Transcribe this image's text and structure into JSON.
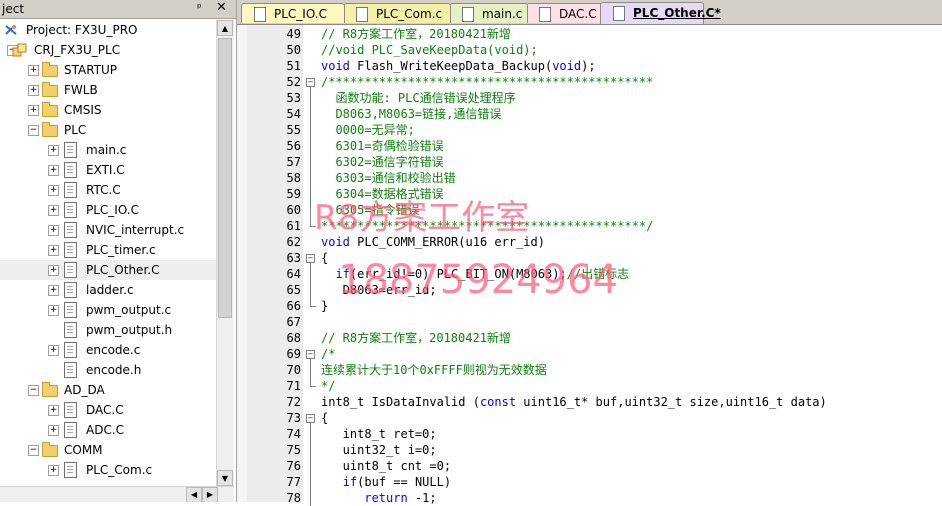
{
  "project_pane": {
    "title": "ject",
    "pin_glyph": "ᵖ",
    "close_glyph": "✕",
    "tree": [
      {
        "label": "Project: FX3U_PRO",
        "level": 0,
        "kind": "project",
        "expander": ""
      },
      {
        "label": "CRJ_FX3U_PLC",
        "level": 1,
        "kind": "target",
        "expander": "−"
      },
      {
        "label": "STARTUP",
        "level": 2,
        "kind": "folder",
        "expander": "+"
      },
      {
        "label": "FWLB",
        "level": 2,
        "kind": "folder",
        "expander": "+"
      },
      {
        "label": "CMSIS",
        "level": 2,
        "kind": "folder",
        "expander": "+"
      },
      {
        "label": "PLC",
        "level": 2,
        "kind": "folder",
        "expander": "−"
      },
      {
        "label": "main.c",
        "level": 3,
        "kind": "file",
        "expander": "+"
      },
      {
        "label": "EXTI.C",
        "level": 3,
        "kind": "file",
        "expander": "+"
      },
      {
        "label": "RTC.C",
        "level": 3,
        "kind": "file",
        "expander": "+"
      },
      {
        "label": "PLC_IO.C",
        "level": 3,
        "kind": "file",
        "expander": "+"
      },
      {
        "label": "NVIC_interrupt.c",
        "level": 3,
        "kind": "file",
        "expander": "+"
      },
      {
        "label": "PLC_timer.c",
        "level": 3,
        "kind": "file",
        "expander": "+"
      },
      {
        "label": "PLC_Other.C",
        "level": 3,
        "kind": "file",
        "expander": "+",
        "selected": true
      },
      {
        "label": "ladder.c",
        "level": 3,
        "kind": "file",
        "expander": "+"
      },
      {
        "label": "pwm_output.c",
        "level": 3,
        "kind": "file",
        "expander": "+"
      },
      {
        "label": "pwm_output.h",
        "level": 3,
        "kind": "file",
        "expander": ""
      },
      {
        "label": "encode.c",
        "level": 3,
        "kind": "file",
        "expander": "+"
      },
      {
        "label": "encode.h",
        "level": 3,
        "kind": "file",
        "expander": ""
      },
      {
        "label": "AD_DA",
        "level": 2,
        "kind": "folder",
        "expander": "−"
      },
      {
        "label": "DAC.C",
        "level": 3,
        "kind": "file",
        "expander": "+"
      },
      {
        "label": "ADC.C",
        "level": 3,
        "kind": "file",
        "expander": "+"
      },
      {
        "label": "COMM",
        "level": 2,
        "kind": "folder",
        "expander": "−"
      },
      {
        "label": "PLC_Com.c",
        "level": 3,
        "kind": "file",
        "expander": "+"
      }
    ]
  },
  "tabs": [
    {
      "label": "PLC_IO.C",
      "color": "#fff7c2",
      "active": false
    },
    {
      "label": "PLC_Com.c",
      "color": "#f5efa8",
      "active": false
    },
    {
      "label": "main.c",
      "color": "#e6f0c4",
      "active": false
    },
    {
      "label": "DAC.C",
      "color": "#fbe1e6",
      "active": false
    },
    {
      "label": "PLC_Other.C*",
      "color": "#e5d9f3",
      "active": true
    }
  ],
  "code_lines": [
    {
      "n": "49",
      "fold": "",
      "spans": [
        [
          "cm",
          "// R8方案工作室，20180421新增"
        ]
      ]
    },
    {
      "n": "50",
      "fold": "",
      "spans": [
        [
          "cm",
          "//void PLC_SaveKeepData(void);"
        ]
      ]
    },
    {
      "n": "51",
      "fold": "",
      "spans": [
        [
          "kw",
          "void"
        ],
        [
          "tx",
          " Flash_WriteKeepData_Backup("
        ],
        [
          "kw",
          "void"
        ],
        [
          "tx",
          ");"
        ]
      ]
    },
    {
      "n": "52",
      "fold": "box",
      "spans": [
        [
          "cm",
          "/*********************************************"
        ]
      ]
    },
    {
      "n": "53",
      "fold": "line",
      "spans": [
        [
          "cm",
          "  函数功能: PLC通信错误处理程序"
        ]
      ]
    },
    {
      "n": "54",
      "fold": "line",
      "spans": [
        [
          "cm",
          "  D8063,M8063=链接,通信错误"
        ]
      ]
    },
    {
      "n": "55",
      "fold": "line",
      "spans": [
        [
          "cm",
          "  0000=无异常;"
        ]
      ]
    },
    {
      "n": "56",
      "fold": "line",
      "spans": [
        [
          "cm",
          "  6301=奇偶检验错误"
        ]
      ]
    },
    {
      "n": "57",
      "fold": "line",
      "spans": [
        [
          "cm",
          "  6302=通信字符错误"
        ]
      ]
    },
    {
      "n": "58",
      "fold": "line",
      "spans": [
        [
          "cm",
          "  6303=通信和校验出错"
        ]
      ]
    },
    {
      "n": "59",
      "fold": "line",
      "spans": [
        [
          "cm",
          "  6304=数据格式错误"
        ]
      ]
    },
    {
      "n": "60",
      "fold": "line",
      "spans": [
        [
          "cm",
          "  6305=指令错误"
        ]
      ]
    },
    {
      "n": "61",
      "fold": "end",
      "spans": [
        [
          "cm",
          "*********************************************/"
        ]
      ]
    },
    {
      "n": "62",
      "fold": "",
      "spans": [
        [
          "kw",
          "void"
        ],
        [
          "tx",
          " PLC_COMM_ERROR(u16 err_id)"
        ]
      ]
    },
    {
      "n": "63",
      "fold": "box",
      "spans": [
        [
          "tx",
          "{"
        ]
      ]
    },
    {
      "n": "64",
      "fold": "line",
      "spans": [
        [
          "tx",
          "  "
        ],
        [
          "kw",
          "if"
        ],
        [
          "tx",
          "(err_id!=0) PLC_BIT_ON(M8063);"
        ],
        [
          "cm",
          "//出错标志"
        ]
      ]
    },
    {
      "n": "65",
      "fold": "line",
      "spans": [
        [
          "tx",
          "   D8063=err_id;"
        ]
      ]
    },
    {
      "n": "66",
      "fold": "end",
      "spans": [
        [
          "tx",
          "}"
        ]
      ]
    },
    {
      "n": "67",
      "fold": "",
      "spans": [
        [
          "tx",
          ""
        ]
      ]
    },
    {
      "n": "68",
      "fold": "",
      "spans": [
        [
          "cm",
          "// R8方案工作室，20180421新增"
        ]
      ]
    },
    {
      "n": "69",
      "fold": "box",
      "spans": [
        [
          "cm",
          "/*"
        ]
      ]
    },
    {
      "n": "70",
      "fold": "line",
      "spans": [
        [
          "cm",
          "连续累计大于10个0xFFFF则视为无效数据"
        ]
      ]
    },
    {
      "n": "71",
      "fold": "end",
      "spans": [
        [
          "cm",
          "*/"
        ]
      ]
    },
    {
      "n": "72",
      "fold": "",
      "spans": [
        [
          "tx",
          "int8_t IsDataInvalid ("
        ],
        [
          "kw",
          "const"
        ],
        [
          "tx",
          " uint16_t* buf,uint32_t size,uint16_t data)"
        ]
      ]
    },
    {
      "n": "73",
      "fold": "box",
      "spans": [
        [
          "tx",
          "{"
        ]
      ]
    },
    {
      "n": "74",
      "fold": "line",
      "spans": [
        [
          "tx",
          "   int8_t ret=0;"
        ]
      ]
    },
    {
      "n": "75",
      "fold": "line",
      "spans": [
        [
          "tx",
          "   uint32_t i=0;"
        ]
      ]
    },
    {
      "n": "76",
      "fold": "line",
      "spans": [
        [
          "tx",
          "   uint8_t cnt =0;"
        ]
      ]
    },
    {
      "n": "77",
      "fold": "line",
      "spans": [
        [
          "tx",
          "   "
        ],
        [
          "kw",
          "if"
        ],
        [
          "tx",
          "(buf == NULL)"
        ]
      ]
    },
    {
      "n": "78",
      "fold": "line",
      "spans": [
        [
          "tx",
          "      "
        ],
        [
          "kw",
          "return"
        ],
        [
          "tx",
          " -1;"
        ]
      ]
    }
  ],
  "watermark": {
    "line1": "R8方案工作室",
    "line2": "18875924964"
  },
  "colors": {
    "comment": "#108010",
    "keyword": "#0000ff",
    "watermark": "#ff5a78"
  }
}
